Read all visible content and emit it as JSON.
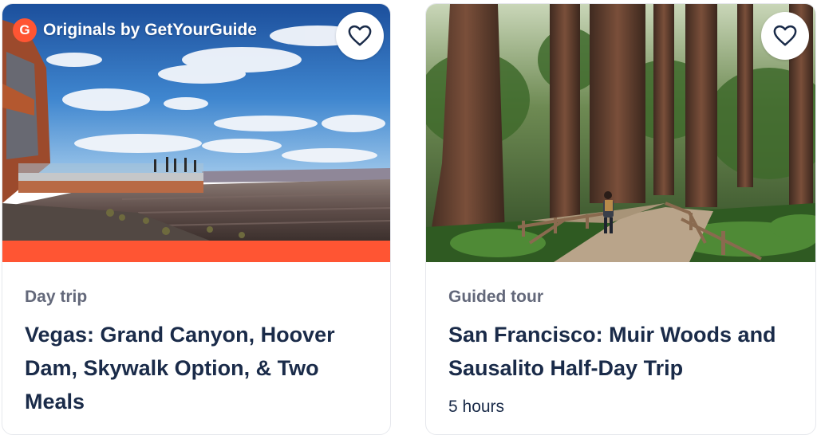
{
  "cards": [
    {
      "badge": {
        "logo_letter": "G",
        "text": "Originals by GetYourGuide"
      },
      "category": "Day trip",
      "title": "Vegas: Grand Canyon, Hoover Dam, Skywalk Option, & Two Meals",
      "favorite_icon": "heart-outline-icon"
    },
    {
      "category": "Guided tour",
      "title": "San Francisco: Muir Woods and Sausalito Half-Day Trip",
      "duration": "5 hours",
      "favorite_icon": "heart-outline-icon"
    }
  ],
  "colors": {
    "brand_orange": "#ff5533",
    "title_navy": "#1a2b49",
    "category_gray": "#63687a"
  }
}
